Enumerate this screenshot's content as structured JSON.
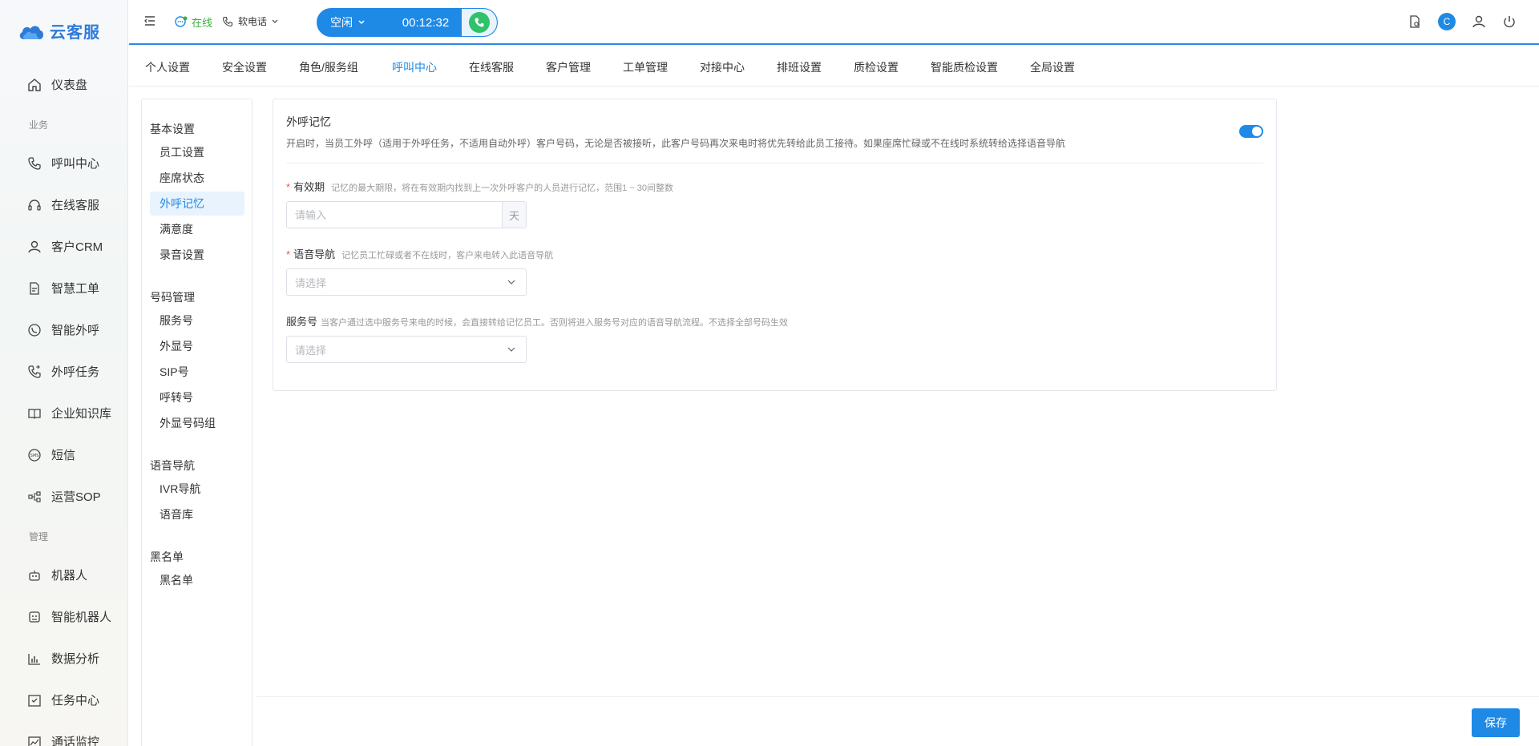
{
  "app": {
    "name": "云客服"
  },
  "sidebar": {
    "items": [
      {
        "label": "仪表盘",
        "icon": "home-icon"
      },
      {
        "label": "呼叫中心",
        "icon": "phone-icon"
      },
      {
        "label": "在线客服",
        "icon": "headset-icon"
      },
      {
        "label": "客户CRM",
        "icon": "user-icon"
      },
      {
        "label": "智慧工单",
        "icon": "document-icon"
      },
      {
        "label": "智能外呼",
        "icon": "whatsapp-icon"
      },
      {
        "label": "外呼任务",
        "icon": "phone-task-icon"
      },
      {
        "label": "企业知识库",
        "icon": "book-icon"
      },
      {
        "label": "短信",
        "icon": "sms-icon"
      },
      {
        "label": "运营SOP",
        "icon": "flow-icon"
      },
      {
        "label": "机器人",
        "icon": "robot-icon"
      },
      {
        "label": "智能机器人",
        "icon": "smart-robot-icon"
      },
      {
        "label": "数据分析",
        "icon": "bar-chart-icon"
      },
      {
        "label": "任务中心",
        "icon": "task-icon"
      },
      {
        "label": "通话监控",
        "icon": "monitor-icon"
      }
    ],
    "groups": {
      "business": "业务",
      "manage": "管理"
    }
  },
  "topbar": {
    "status": "在线",
    "phone_mode": "软电话",
    "call_state": "空闲",
    "call_timer": "00:12:32",
    "avatar_letter": "C"
  },
  "tabs": [
    {
      "label": "个人设置"
    },
    {
      "label": "安全设置"
    },
    {
      "label": "角色/服务组"
    },
    {
      "label": "呼叫中心",
      "active": true
    },
    {
      "label": "在线客服"
    },
    {
      "label": "客户管理"
    },
    {
      "label": "工单管理"
    },
    {
      "label": "对接中心"
    },
    {
      "label": "排班设置"
    },
    {
      "label": "质检设置"
    },
    {
      "label": "智能质检设置"
    },
    {
      "label": "全局设置"
    }
  ],
  "submenu": {
    "groups": [
      {
        "title": "基本设置",
        "items": [
          "员工设置",
          "座席状态",
          "外呼记忆",
          "满意度",
          "录音设置"
        ]
      },
      {
        "title": "号码管理",
        "items": [
          "服务号",
          "外显号",
          "SIP号",
          "呼转号",
          "外显号码组"
        ]
      },
      {
        "title": "语音导航",
        "items": [
          "IVR导航",
          "语音库"
        ]
      },
      {
        "title": "黑名单",
        "items": [
          "黑名单"
        ]
      }
    ],
    "active_item": "外呼记忆"
  },
  "card": {
    "title": "外呼记忆",
    "description": "开启时，当员工外呼（适用于外呼任务，不适用自动外呼）客户号码，无论是否被接听，此客户号码再次来电时将优先转给此员工接待。如果座席忙碌或不在线时系统转给选择语音导航",
    "enabled": true,
    "fields": {
      "validity": {
        "label": "有效期",
        "required": true,
        "hint": "记忆的最大期限，将在有效期内找到上一次外呼客户的人员进行记忆，范围1 ~ 30间整数",
        "placeholder": "请输入",
        "unit": "天"
      },
      "voice_nav": {
        "label": "语音导航",
        "required": true,
        "hint": "记忆员工忙碌或者不在线时，客户来电转入此语音导航",
        "placeholder": "请选择"
      },
      "service_number": {
        "label": "服务号",
        "required": false,
        "hint": "当客户通过选中服务号来电的时候，会直接转给记忆员工。否则将进入服务号对应的语音导航流程。不选择全部号码生效",
        "placeholder": "请选择"
      }
    }
  },
  "footer": {
    "save_label": "保存"
  },
  "colors": {
    "primary": "#1f8ae6",
    "online": "#38b03f",
    "call_green": "#2fc26a",
    "required": "#f05252"
  }
}
